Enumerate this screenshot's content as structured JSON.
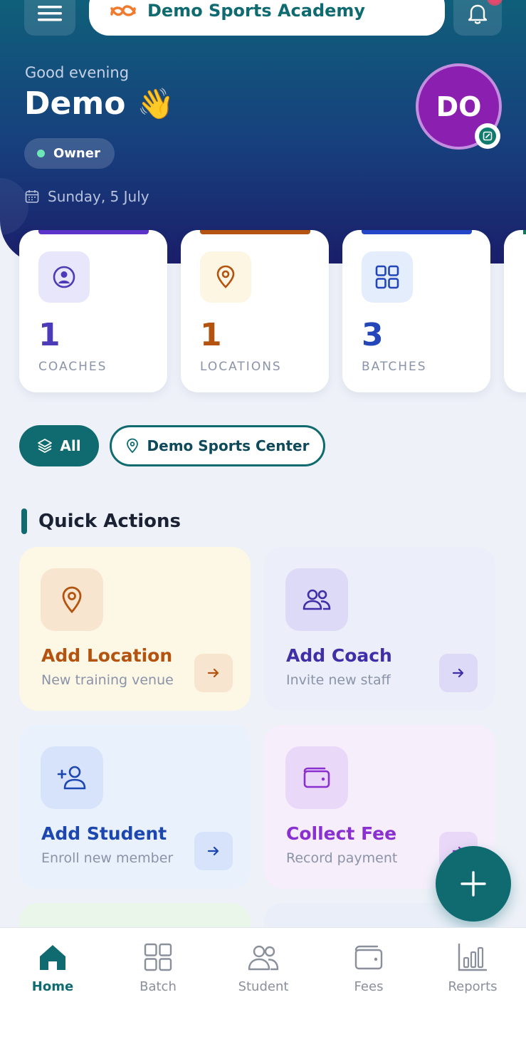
{
  "header": {
    "brand_name": "Demo Sports Academy",
    "greeting": "Good evening",
    "user_name": "Demo",
    "wave_emoji": "👋",
    "role": "Owner",
    "date": "Sunday, 5 July",
    "avatar_initials": "DO"
  },
  "stats": [
    {
      "value": "1",
      "label": "COACHES",
      "color": "#4c3bb8",
      "bar_color": "#5b33c9",
      "icon_bg": "#e8e6fb"
    },
    {
      "value": "1",
      "label": "LOCATIONS",
      "color": "#b4530f",
      "bar_color": "#b4530f",
      "icon_bg": "#fdf6e3"
    },
    {
      "value": "3",
      "label": "BATCHES",
      "color": "#2347b8",
      "bar_color": "#2347c8",
      "icon_bg": "#e4edfb"
    }
  ],
  "filters": {
    "all_label": "All",
    "location_label": "Demo Sports Center"
  },
  "quick_actions": {
    "title": "Quick Actions",
    "items": [
      {
        "name": "Add Location",
        "sub": "New training venue",
        "color": "#b4530f"
      },
      {
        "name": "Add Coach",
        "sub": "Invite new staff",
        "color": "#3f2ea8"
      },
      {
        "name": "Add Student",
        "sub": "Enroll new member",
        "color": "#1d47b0"
      },
      {
        "name": "Collect Fee",
        "sub": "Record payment",
        "color": "#8a2fd0"
      }
    ]
  },
  "nav": {
    "items": [
      {
        "label": "Home"
      },
      {
        "label": "Batch"
      },
      {
        "label": "Student"
      },
      {
        "label": "Fees"
      },
      {
        "label": "Reports"
      }
    ]
  }
}
